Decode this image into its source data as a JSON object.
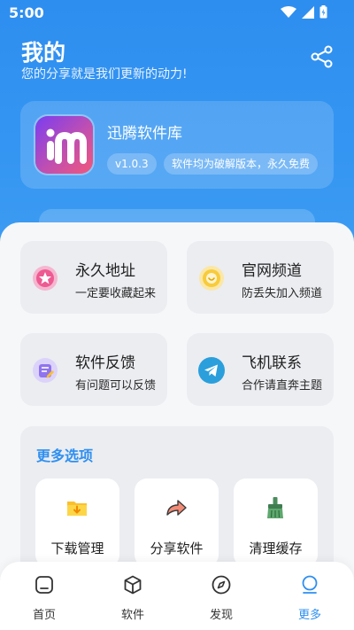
{
  "status_bar": {
    "time": "5:00"
  },
  "header": {
    "title": "我的",
    "subtitle": "您的分享就是我们更新的动力!"
  },
  "app_card": {
    "name": "迅腾软件库",
    "version": "v1.0.3",
    "description": "软件均为破解版本，永久免费"
  },
  "tiles": [
    {
      "title": "永久地址",
      "subtitle": "一定要收藏起来",
      "icon": "star-badge-icon"
    },
    {
      "title": "官网频道",
      "subtitle": "防丢失加入频道",
      "icon": "smile-coin-icon"
    },
    {
      "title": "软件反馈",
      "subtitle": "有问题可以反馈",
      "icon": "feedback-icon"
    },
    {
      "title": "飞机联系",
      "subtitle": "合作请直奔主题",
      "icon": "telegram-icon"
    }
  ],
  "more": {
    "title": "更多选项",
    "items": [
      {
        "label": "下载管理",
        "icon": "download-folder-icon"
      },
      {
        "label": "分享软件",
        "icon": "share-arrow-icon"
      },
      {
        "label": "清理缓存",
        "icon": "broom-icon"
      }
    ]
  },
  "nav": {
    "items": [
      {
        "label": "首页",
        "icon": "home-icon"
      },
      {
        "label": "软件",
        "icon": "box-icon"
      },
      {
        "label": "发现",
        "icon": "compass-icon"
      },
      {
        "label": "更多",
        "icon": "more-icon"
      }
    ],
    "active_index": 3
  },
  "colors": {
    "header_blue": "#2e8ef0",
    "accent": "#2f8ff0",
    "tile_bg": "#ebedf1"
  }
}
